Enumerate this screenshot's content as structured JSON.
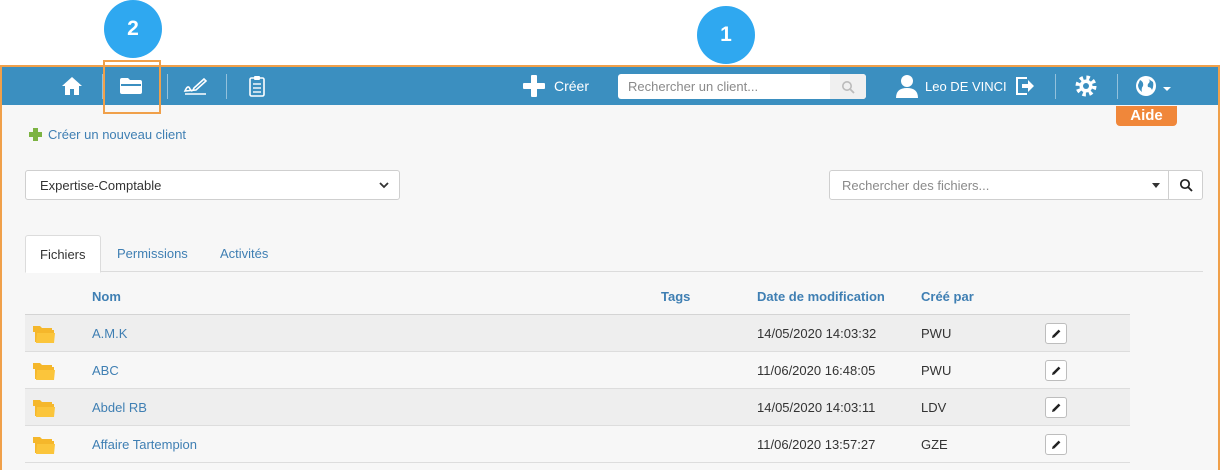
{
  "callouts": {
    "one": "1",
    "two": "2"
  },
  "navbar": {
    "create_label": "Créer",
    "search_placeholder": "Rechercher un client...",
    "user_name": "Leo DE VINCI",
    "help_badge": "Aide",
    "icons": [
      "home-icon",
      "folder-icon",
      "signature-icon",
      "clipboard-icon",
      "plus-icon",
      "search-icon",
      "user-icon",
      "logout-icon",
      "gear-icon",
      "globe-icon"
    ]
  },
  "content": {
    "new_client_label": "Créer un nouveau client",
    "category_select": "Expertise-Comptable",
    "file_search_placeholder": "Rechercher des fichiers..."
  },
  "tabs": [
    {
      "label": "Fichiers",
      "active": true
    },
    {
      "label": "Permissions",
      "active": false
    },
    {
      "label": "Activités",
      "active": false
    }
  ],
  "table": {
    "columns": {
      "name": "Nom",
      "tags": "Tags",
      "modified": "Date de modification",
      "author": "Créé par"
    },
    "rows": [
      {
        "name": "A.M.K",
        "tags": "",
        "modified": "14/05/2020 14:03:32",
        "author": "PWU"
      },
      {
        "name": "ABC",
        "tags": "",
        "modified": "11/06/2020 16:48:05",
        "author": "PWU"
      },
      {
        "name": "Abdel RB",
        "tags": "",
        "modified": "14/05/2020 14:03:11",
        "author": "LDV"
      },
      {
        "name": "Affaire Tartempion",
        "tags": "",
        "modified": "11/06/2020 13:57:27",
        "author": "GZE"
      }
    ]
  },
  "colors": {
    "navbar": "#3b8fc0",
    "accent_orange": "#f0873a",
    "callout_blue": "#2fa8f0",
    "link": "#3f7fb3",
    "folder": "#f5b72b"
  }
}
